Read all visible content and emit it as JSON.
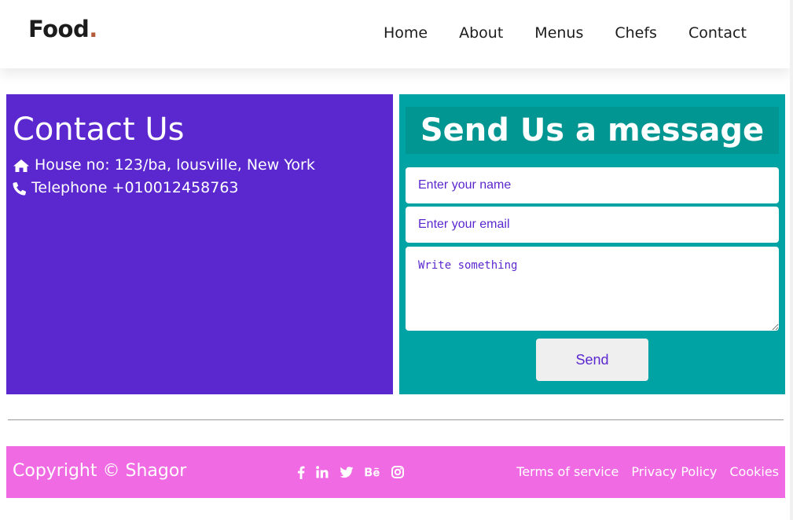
{
  "navbar": {
    "logo_text": "Food",
    "logo_dot": ".",
    "links": [
      "Home",
      "About",
      "Menus",
      "Chefs",
      "Contact"
    ]
  },
  "contact": {
    "title": "Contact Us",
    "address": "House no: 123/ba, lousville, New York",
    "telephone": "Telephone +010012458763"
  },
  "message_form": {
    "title": "Send Us a message",
    "name_placeholder": "Enter your name",
    "email_placeholder": "Enter your email",
    "message_placeholder": "Write something",
    "send_label": "Send"
  },
  "footer": {
    "copyright": "Copyright © Shagor",
    "socials": [
      "facebook-icon",
      "linkedin-icon",
      "twitter-icon",
      "behance-icon",
      "instagram-icon"
    ],
    "links": [
      "Terms of service",
      "Privacy Policy",
      "Cookies"
    ]
  },
  "colors": {
    "accent_purple": "#5b27cf",
    "teal": "#00a3a3",
    "teal_dark": "#029693",
    "pink": "#f06ae3",
    "logo_dot": "#b35a3a"
  }
}
